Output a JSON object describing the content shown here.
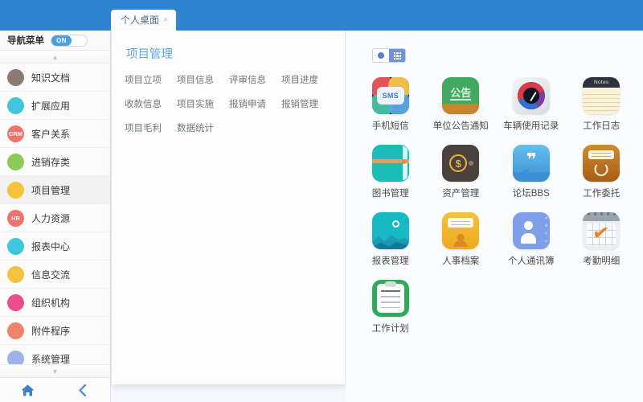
{
  "header": {
    "tabs": [
      {
        "label": "个人桌面",
        "close": "×",
        "active": true
      }
    ]
  },
  "sidebar": {
    "nav_toggle": {
      "label": "导航菜单",
      "state": "ON"
    },
    "scroll_up": "▲",
    "scroll_down": "▼",
    "items": [
      {
        "label": "知识文档",
        "icon": "book-icon",
        "glyph": "",
        "color": "#8c7b72",
        "active": false
      },
      {
        "label": "扩展应用",
        "icon": "apps-icon",
        "glyph": "",
        "color": "#3fc6dd",
        "active": false
      },
      {
        "label": "客户关系",
        "icon": "crm-icon",
        "glyph": "CRM",
        "color": "#f0736a",
        "active": false
      },
      {
        "label": "进销存类",
        "icon": "inventory-icon",
        "glyph": "",
        "color": "#8ccb5a",
        "active": false
      },
      {
        "label": "项目管理",
        "icon": "project-icon",
        "glyph": "",
        "color": "#f5c23e",
        "active": true
      },
      {
        "label": "人力资源",
        "icon": "hr-icon",
        "glyph": "HR",
        "color": "#f0736a",
        "active": false
      },
      {
        "label": "报表中心",
        "icon": "report-icon",
        "glyph": "",
        "color": "#3fc6dd",
        "active": false
      },
      {
        "label": "信息交流",
        "icon": "message-icon",
        "glyph": "",
        "color": "#f5c23e",
        "active": false
      },
      {
        "label": "组织机构",
        "icon": "org-icon",
        "glyph": "",
        "color": "#ea4f8c",
        "active": false
      },
      {
        "label": "附件程序",
        "icon": "attachment-icon",
        "glyph": "",
        "color": "#f0836a",
        "active": false
      },
      {
        "label": "系统管理",
        "icon": "system-icon",
        "glyph": "",
        "color": "#9fb3e8",
        "active": false
      }
    ],
    "footer": {
      "home": "home-icon",
      "back": "back-chevron-icon"
    }
  },
  "dropdown": {
    "title": "项目管理",
    "items": [
      "项目立项",
      "项目信息",
      "评审信息",
      "项目进度",
      "收款信息",
      "项目实施",
      "报销申请",
      "报销管理",
      "项目毛利",
      "数据统计"
    ]
  },
  "main": {
    "view_toggle": {
      "list_option": "list-view",
      "grid_option": "grid-view",
      "selected": "grid-view"
    },
    "apps": [
      {
        "label": "手机短信",
        "icon": "sms-icon",
        "art": "ic-sms",
        "badge": "SMS"
      },
      {
        "label": "单位公告通知",
        "icon": "announcement-icon",
        "art": "ic-gonggao",
        "badge": "公告"
      },
      {
        "label": "车辆使用记录",
        "icon": "vehicle-icon",
        "art": "ic-car",
        "badge": ""
      },
      {
        "label": "工作日志",
        "icon": "notes-icon",
        "art": "ic-notes",
        "badge": "Notes"
      },
      {
        "label": "图书管理",
        "icon": "library-icon",
        "art": "ic-book",
        "badge": ""
      },
      {
        "label": "资产管理",
        "icon": "asset-icon",
        "art": "ic-asset",
        "badge": "$"
      },
      {
        "label": "论坛BBS",
        "icon": "forum-icon",
        "art": "ic-bbs",
        "badge": "❞"
      },
      {
        "label": "工作委托",
        "icon": "delegate-icon",
        "art": "ic-weituo",
        "badge": ""
      },
      {
        "label": "报表管理",
        "icon": "report-chart-icon",
        "art": "ic-report",
        "badge": ""
      },
      {
        "label": "人事档案",
        "icon": "personnel-icon",
        "art": "ic-hr",
        "badge": ""
      },
      {
        "label": "个人通讯簿",
        "icon": "contacts-icon",
        "art": "ic-contacts",
        "badge": ""
      },
      {
        "label": "考勤明细",
        "icon": "attendance-icon",
        "art": "ic-cal",
        "badge": "✔"
      },
      {
        "label": "工作计划",
        "icon": "plan-icon",
        "art": "ic-plan",
        "badge": ""
      }
    ]
  },
  "colors": {
    "header_blue": "#2f84d0",
    "accent_blue": "#62a8dd",
    "tab_bg": "#fdfdfd"
  }
}
